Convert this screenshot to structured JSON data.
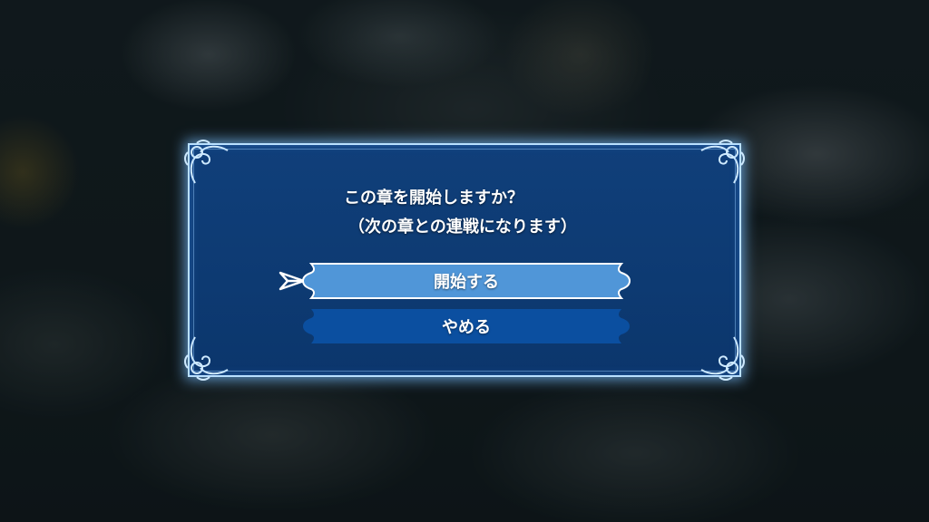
{
  "dialog": {
    "message_line1": "この章を開始しますか？",
    "message_line2": "（次の章との連戦になります）"
  },
  "options": {
    "start_label": "開始する",
    "cancel_label": "やめる",
    "selected": "開始する"
  },
  "colors": {
    "panel": "#0d3a72",
    "panel_border": "#b9e0ff",
    "button_selected": "#5096d8",
    "button_normal": "#0b4fa0"
  },
  "icons": {
    "cursor": "arrow-cursor-icon",
    "ornament": "corner-ornament-icon"
  }
}
